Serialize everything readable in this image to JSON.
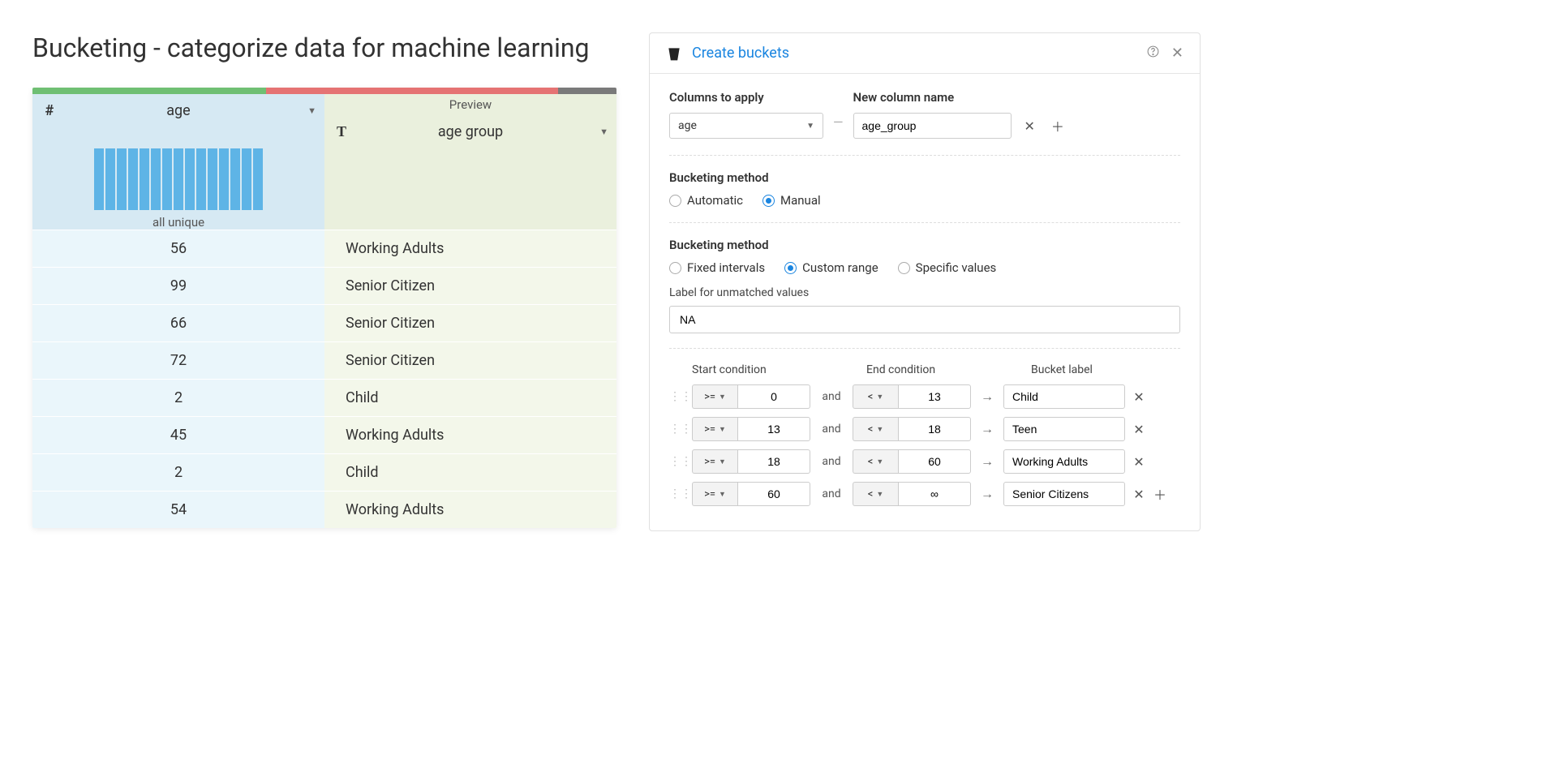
{
  "page_title": "Bucketing - categorize data for machine learning",
  "table": {
    "preview_label": "Preview",
    "col_age": "age",
    "col_group": "age group",
    "all_unique": "all unique",
    "rows": [
      {
        "age": "56",
        "group": "Working Adults"
      },
      {
        "age": "99",
        "group": "Senior Citizen"
      },
      {
        "age": "66",
        "group": "Senior Citizen"
      },
      {
        "age": "72",
        "group": "Senior Citizen"
      },
      {
        "age": "2",
        "group": "Child"
      },
      {
        "age": "45",
        "group": "Working Adults"
      },
      {
        "age": "2",
        "group": "Child"
      },
      {
        "age": "54",
        "group": "Working Adults"
      }
    ]
  },
  "panel": {
    "title": "Create buckets",
    "columns_apply_label": "Columns to apply",
    "columns_apply_value": "age",
    "new_column_label": "New column name",
    "new_column_value": "age_group",
    "method_label": "Bucketing method",
    "method_auto": "Automatic",
    "method_manual": "Manual",
    "method2_label": "Bucketing method",
    "method2_fixed": "Fixed intervals",
    "method2_custom": "Custom range",
    "method2_specific": "Specific values",
    "unmatched_label": "Label for unmatched values",
    "unmatched_value": "NA",
    "cond_head_start": "Start condition",
    "cond_head_end": "End condition",
    "cond_head_label": "Bucket label",
    "and_text": "and",
    "rows": [
      {
        "start_op": ">=",
        "start_val": "0",
        "end_op": "<",
        "end_val": "13",
        "label": "Child"
      },
      {
        "start_op": ">=",
        "start_val": "13",
        "end_op": "<",
        "end_val": "18",
        "label": "Teen"
      },
      {
        "start_op": ">=",
        "start_val": "18",
        "end_op": "<",
        "end_val": "60",
        "label": "Working Adults"
      },
      {
        "start_op": ">=",
        "start_val": "60",
        "end_op": "<",
        "end_val": "∞",
        "label": "Senior Citizens"
      }
    ]
  }
}
